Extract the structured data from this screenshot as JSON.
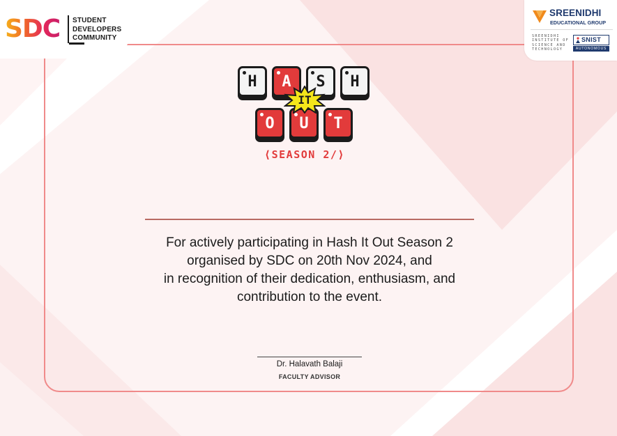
{
  "colors": {
    "frame": "#f08a8a",
    "accent_red": "#e23b3b",
    "navy": "#1f3a6e",
    "rule": "#b86a62"
  },
  "sdc_logo": {
    "mark": "SDC",
    "lines": [
      "STUDENT",
      "DEVELOPERS",
      "COMMUNITY"
    ]
  },
  "sreenidhi_logo": {
    "name": "SREENIDHI",
    "subtitle": "EDUCATIONAL GROUP",
    "institute_lines": [
      "SREENIDHI",
      "INSTITUTE OF",
      "SCIENCE AND",
      "TECHNOLOGY"
    ],
    "badge": "SNIST",
    "badge_sub": "AUTONOMOUS"
  },
  "event_logo": {
    "row1": [
      "H",
      "A",
      "S",
      "H"
    ],
    "middle": "IT",
    "row2": [
      "O",
      "U",
      "T"
    ],
    "season": "⟨SEASON 2/⟩"
  },
  "certificate": {
    "lines": [
      "For actively participating in Hash It Out Season 2",
      "organised by SDC on 20th Nov 2024, and",
      "in recognition of their dedication, enthusiasm, and",
      "contribution to the event."
    ]
  },
  "signature": {
    "name": "Dr. Halavath Balaji",
    "role": "FACULTY ADVISOR"
  }
}
